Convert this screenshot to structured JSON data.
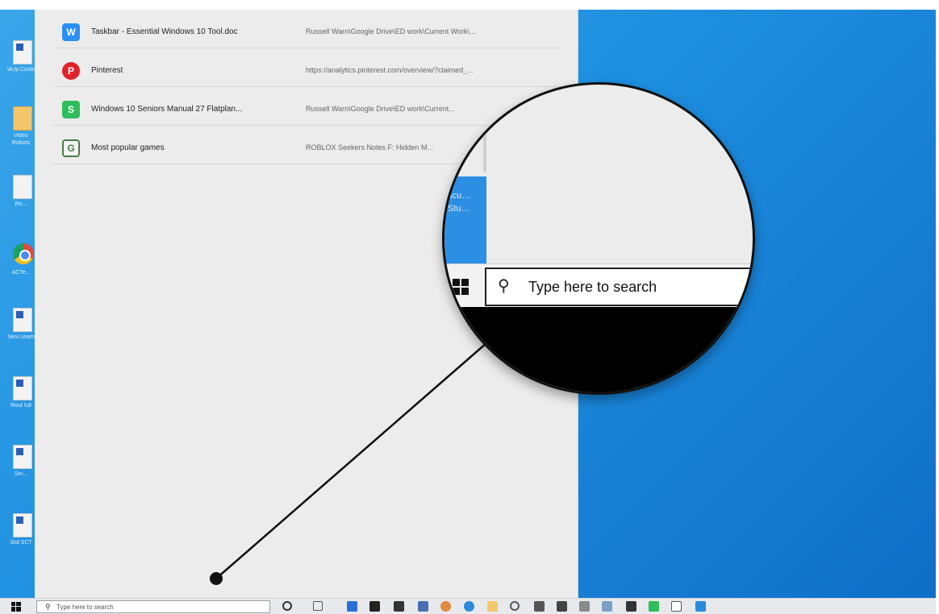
{
  "desktop": {
    "icons": [
      {
        "name": "word-doc-icon",
        "label": "wUp\nCosts"
      },
      {
        "name": "folder-icon",
        "label": "Video\nRobots"
      },
      {
        "name": "doc-icon",
        "label": "Ro..."
      },
      {
        "name": "chrome-icon",
        "label": "ACTe..."
      },
      {
        "name": "doc-icon",
        "label": "Seni\nLearn"
      },
      {
        "name": "doc-icon",
        "label": "Rout\nfull"
      },
      {
        "name": "doc-icon",
        "label": "Sei..."
      },
      {
        "name": "doc-icon",
        "label": "Slid\nSCT"
      }
    ]
  },
  "search_panel": {
    "results": [
      {
        "icon": "W",
        "icon_color": "#2b8ff3",
        "title": "Taskbar - Essential Windows 10 Tool.doc",
        "path": "Russell Warn\\Google Drive\\ED work\\Current Work\\..."
      },
      {
        "icon": "P",
        "icon_color": "#e1232b",
        "title": "Pinterest",
        "path": "https://analytics.pinterest.com/overview/?claimed_..."
      },
      {
        "icon": "S",
        "icon_color": "#2ebd5b",
        "title": "Windows 10 Seniors Manual 27 Flatplan...",
        "path": "Russell Warn\\Google Drive\\ED work\\Current..."
      },
      {
        "icon": "G",
        "icon_color": "#4a7a4a",
        "title": "Most popular games",
        "path": "ROBLOX Seekers Notes F: Hidden M..."
      }
    ]
  },
  "taskbar": {
    "search_placeholder": "Type here to search",
    "icons": [
      "search-icon",
      "task-view-icon",
      "people-icon",
      "store-icon",
      "package-icon",
      "chrome-icon",
      "edge-icon",
      "folder-icon",
      "settings-icon",
      "calendar-icon",
      "photos-icon",
      "scissors-icon",
      "network-icon",
      "calculator-icon",
      "green-app-icon",
      "notepad-icon",
      "outlook-icon"
    ]
  },
  "magnifier": {
    "search_placeholder": "Type here to search",
    "blue_text": "scu…\nStu…"
  },
  "colors": {
    "desktop_blue": "#1e8fe0",
    "panel_bg": "#ececec",
    "taskbar_bg": "#e7e9ec"
  }
}
